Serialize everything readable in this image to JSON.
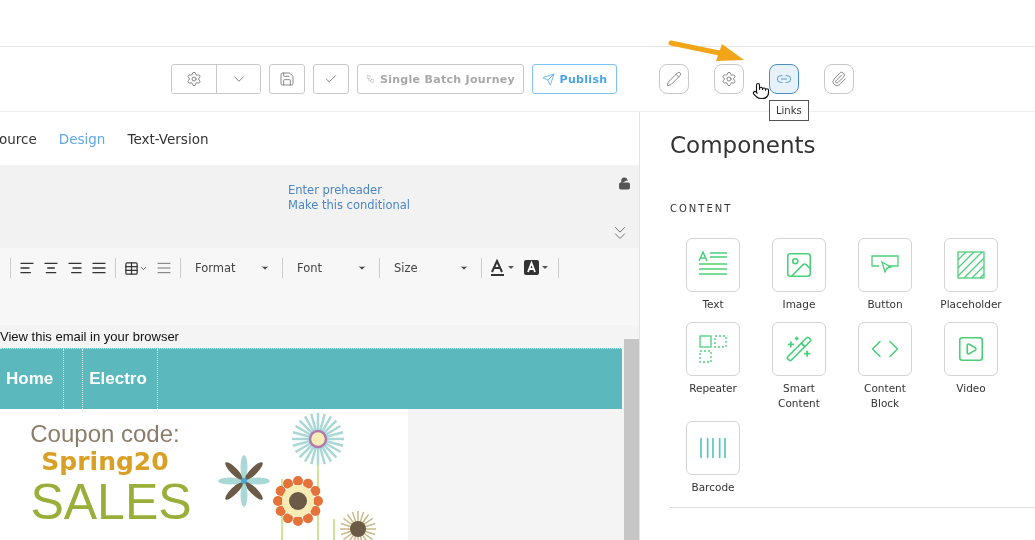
{
  "toolbar": {
    "buttons": [
      {
        "kind": "settings-menu",
        "selected": false
      },
      {
        "kind": "save",
        "selected": false
      },
      {
        "kind": "approve",
        "selected": false
      },
      {
        "kind": "journey",
        "label": "Single Batch Journey",
        "disabled": true,
        "selected": false
      },
      {
        "kind": "publish",
        "label": "Publish",
        "disabled": false,
        "selected": false
      },
      {
        "kind": "edit",
        "selected": false
      },
      {
        "kind": "settings",
        "selected": false
      },
      {
        "kind": "links",
        "selected": true
      },
      {
        "kind": "attach",
        "selected": false
      }
    ],
    "tooltip": "Links"
  },
  "editor": {
    "tabs": [
      {
        "label": "ource",
        "selected": false
      },
      {
        "label": "Design",
        "selected": true
      },
      {
        "label": "Text-Version",
        "selected": false
      }
    ],
    "preheader": [
      "Enter preheader",
      "Make this conditional"
    ],
    "dropdowns": [
      "Format",
      "Font",
      "Size"
    ],
    "email": {
      "view_link": "View this email in your browser",
      "nav": [
        "Home",
        "Electro"
      ],
      "promo": {
        "coupon_label": "Coupon code:",
        "code": "Spring20",
        "headline": "SALES"
      }
    }
  },
  "components": {
    "title": "Components",
    "section": "CONTENT",
    "items": [
      {
        "kind": "text",
        "label": "Text"
      },
      {
        "kind": "image",
        "label": "Image"
      },
      {
        "kind": "button",
        "label": "Button"
      },
      {
        "kind": "placeholder",
        "label": "Placeholder"
      },
      {
        "kind": "repeater",
        "label": "Repeater"
      },
      {
        "kind": "smart",
        "label": "Smart Content"
      },
      {
        "kind": "block",
        "label": "Content Block"
      },
      {
        "kind": "video",
        "label": "Video"
      },
      {
        "kind": "barcode",
        "label": "Barcode"
      }
    ]
  }
}
